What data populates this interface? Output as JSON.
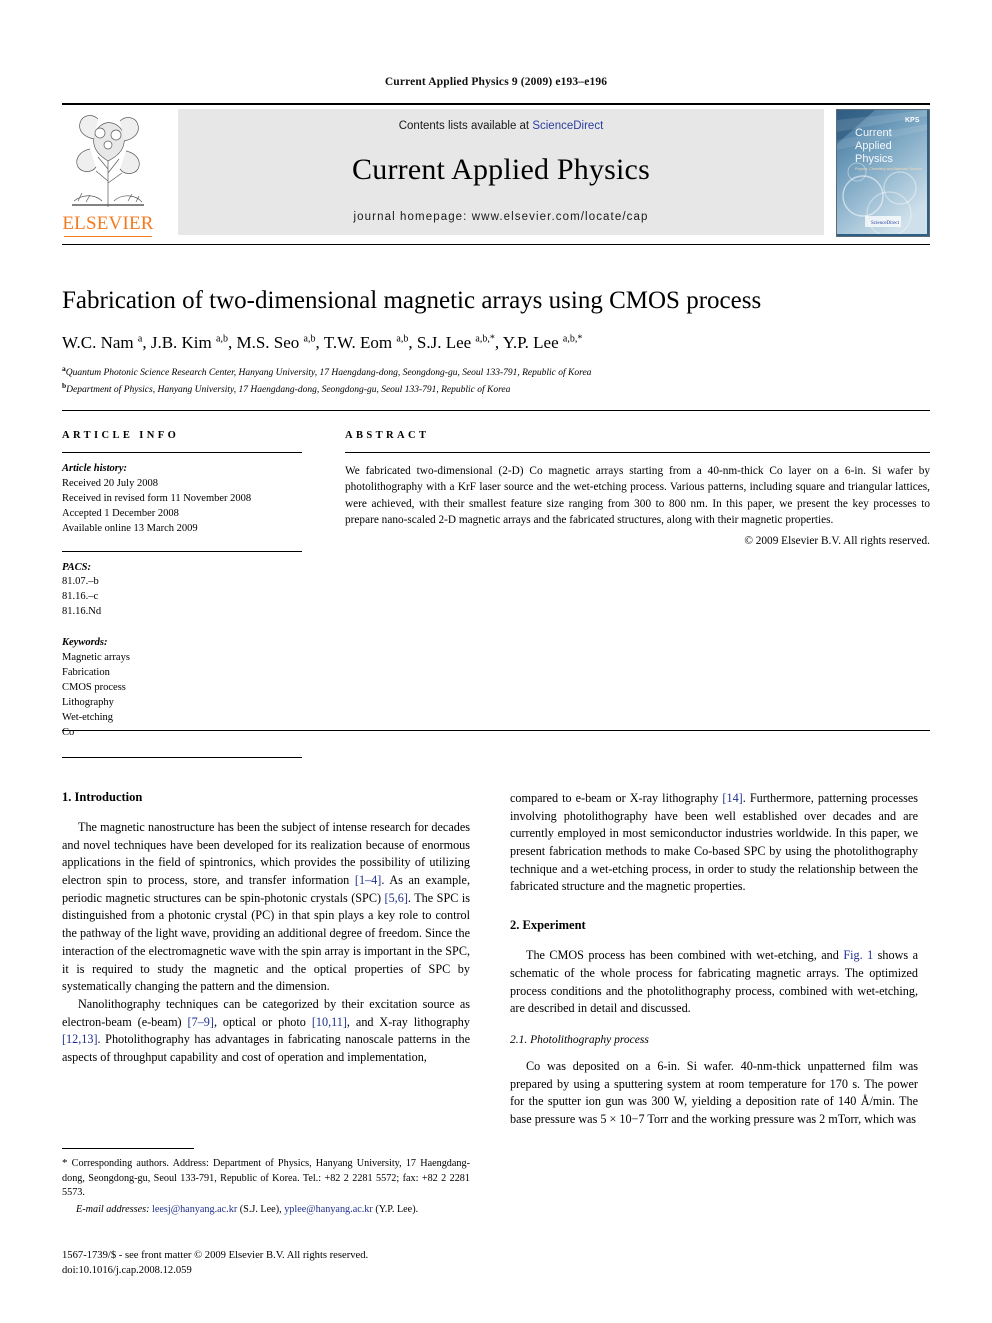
{
  "running_head": "Current Applied Physics  9 (2009) e193–e196",
  "masthead": {
    "publisher_name": "ELSEVIER",
    "contents_prefix": "Contents lists available at ",
    "contents_link": "ScienceDirect",
    "journal_title": "Current Applied Physics",
    "homepage": "journal homepage: www.elsevier.com/locate/cap",
    "cover": {
      "line1": "Current",
      "line2": "Applied",
      "line3": "Physics",
      "subtitle": "Physics, Chemistry and Materials Science",
      "badge": "KPS",
      "footer": "ScienceDirect"
    }
  },
  "article": {
    "title": "Fabrication of two-dimensional magnetic arrays using CMOS process",
    "authors": "W.C. Nam a, J.B. Kim a,b, M.S. Seo a,b, T.W. Eom a,b, S.J. Lee a,b,*, Y.P. Lee a,b,*",
    "affiliation_a": "Quantum Photonic Science Research Center, Hanyang University, 17 Haengdang-dong, Seongdong-gu, Seoul 133-791, Republic of Korea",
    "affiliation_b": "Department of Physics, Hanyang University, 17 Haengdang-dong, Seongdong-gu, Seoul 133-791, Republic of Korea"
  },
  "article_info": {
    "label": "ARTICLE INFO",
    "history_label": "Article history:",
    "history": [
      "Received 20 July 2008",
      "Received in revised form 11 November 2008",
      "Accepted 1 December 2008",
      "Available online 13 March 2009"
    ],
    "pacs_label": "PACS:",
    "pacs": [
      "81.07.–b",
      "81.16.–c",
      "81.16.Nd"
    ],
    "keywords_label": "Keywords:",
    "keywords": [
      "Magnetic arrays",
      "Fabrication",
      "CMOS process",
      "Lithography",
      "Wet-etching",
      "Co"
    ]
  },
  "abstract": {
    "label": "ABSTRACT",
    "text": "We fabricated two-dimensional (2-D) Co magnetic arrays starting from a 40-nm-thick Co layer on a 6-in. Si wafer by photolithography with a KrF laser source and the wet-etching process. Various patterns, including square and triangular lattices, were achieved, with their smallest feature size ranging from 300 to 800 nm. In this paper, we present the key processes to prepare nano-scaled 2-D magnetic arrays and the fabricated structures, along with their magnetic properties.",
    "copyright": "© 2009 Elsevier B.V. All rights reserved."
  },
  "sections": {
    "introduction_heading": "1. Introduction",
    "intro_p1_a": "The magnetic nanostructure has been the subject of intense research for decades and novel techniques have been developed for its realization because of enormous applications in the field of spintronics, which provides the possibility of utilizing electron spin to process, store, and transfer information ",
    "intro_p1_ref1": "[1–4]",
    "intro_p1_b": ". As an example, periodic magnetic structures can be spin-photonic crystals (SPC) ",
    "intro_p1_ref2": "[5,6]",
    "intro_p1_c": ". The SPC is distinguished from a photonic crystal (PC) in that spin plays a key role to control the pathway of the light wave, providing an additional degree of freedom. Since the interaction of the electromagnetic wave with the spin array is important in the SPC, it is required to study the magnetic and the optical properties of SPC by systematically changing the pattern and the dimension.",
    "intro_p2_a": "Nanolithography techniques can be categorized by their excitation source as electron-beam (e-beam) ",
    "intro_p2_ref1": "[7–9]",
    "intro_p2_b": ", optical or photo ",
    "intro_p2_ref2": "[10,11]",
    "intro_p2_c": ", and X-ray lithography ",
    "intro_p2_ref3": "[12,13]",
    "intro_p2_d": ". Photolithography has advantages in fabricating nanoscale patterns in the aspects of throughput capability and cost of operation and implementation,",
    "intro_p3_a": "compared to e-beam or X-ray lithography ",
    "intro_p3_ref1": "[14]",
    "intro_p3_b": ". Furthermore, patterning processes involving photolithography have been well established over decades and are currently employed in most semiconductor industries worldwide. In this paper, we present fabrication methods to make Co-based SPC by using the photolithography technique and a wet-etching process, in order to study the relationship between the fabricated structure and the magnetic properties.",
    "experiment_heading": "2. Experiment",
    "exp_p1_a": "The CMOS process has been combined with wet-etching, and ",
    "exp_p1_ref1": "Fig. 1",
    "exp_p1_b": " shows a schematic of the whole process for fabricating magnetic arrays. The optimized process conditions and the photolithography process, combined with wet-etching, are described in detail and discussed.",
    "photolithography_subheading": "2.1. Photolithography process",
    "photo_p1": "Co was deposited on a 6-in. Si wafer. 40-nm-thick unpatterned film was prepared by using a sputtering system at room temperature for 170 s. The power for the sputter ion gun was 300 W, yielding a deposition rate of 140 Å/min. The base pressure was 5 × 10−7 Torr and the working pressure was 2 mTorr, which was"
  },
  "footnotes": {
    "corresponding_star": "*",
    "corresponding_text": " Corresponding authors. Address: Department of Physics, Hanyang University, 17 Haengdang-dong, Seongdong-gu, Seoul 133-791, Republic of Korea. Tel.: +82 2 2281 5572; fax: +82 2 2281 5573.",
    "email_label": "E-mail addresses:",
    "email_1": "leesj@hanyang.ac.kr",
    "email_1_owner": " (S.J. Lee), ",
    "email_2": "yplee@hanyang.ac.kr",
    "email_2_owner": " (Y.P. Lee).",
    "issn_line": "1567-1739/$ - see front matter © 2009 Elsevier B.V. All rights reserved.",
    "doi_line": "doi:10.1016/j.cap.2008.12.059"
  },
  "colors": {
    "link": "#1f2f8c",
    "elsevier_orange": "#F47A20",
    "band_gray": "#e7e7e7"
  }
}
